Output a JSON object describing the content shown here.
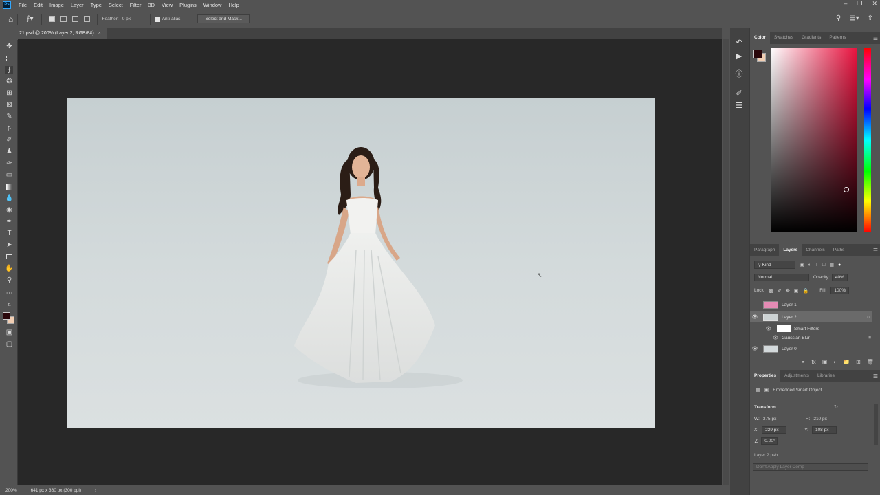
{
  "menu": {
    "app_logo": "Ps",
    "items": [
      "File",
      "Edit",
      "Image",
      "Layer",
      "Type",
      "Select",
      "Filter",
      "3D",
      "View",
      "Plugins",
      "Window",
      "Help"
    ]
  },
  "options": {
    "feather_label": "Feather:",
    "feather_value": "0 px",
    "antialias_label": "Anti-alias",
    "select_mask_label": "Select and Mask..."
  },
  "document": {
    "tab_title": "21.psd @ 200% (Layer 2, RGB/8#)",
    "zoom": "200%",
    "status_info": "641 px x 360 px (300 ppi)"
  },
  "color_panel": {
    "tabs": [
      "Color",
      "Swatches",
      "Gradients",
      "Patterns"
    ],
    "foreground": "#2a070b",
    "background": "#f1ceb3",
    "hue": "#e8133f"
  },
  "layers_panel": {
    "tabs": [
      "Paragraph",
      "Layers",
      "Channels",
      "Paths"
    ],
    "filter_kind": "Kind",
    "blend_mode": "Normal",
    "opacity_label": "Opacity:",
    "opacity_value": "40%",
    "lock_label": "Lock:",
    "fill_label": "Fill:",
    "fill_value": "100%",
    "layers": [
      {
        "name": "Layer 1",
        "visible": false
      },
      {
        "name": "Layer 2",
        "visible": true,
        "selected": true
      },
      {
        "name": "Smart Filters",
        "visible": true
      },
      {
        "name": "Gaussian Blur",
        "visible": true
      },
      {
        "name": "Layer 0",
        "visible": true
      }
    ]
  },
  "properties_panel": {
    "tabs": [
      "Properties",
      "Adjustments",
      "Libraries"
    ],
    "type_label": "Embedded Smart Object",
    "transform_label": "Transform",
    "w_label": "W:",
    "w_value": "375 px",
    "h_label": "H:",
    "h_value": "210 px",
    "x_label": "X:",
    "x_value": "229 px",
    "y_label": "Y:",
    "y_value": "108 px",
    "angle_value": "0.00°",
    "layer_file": "Layer 2.psb",
    "layer_comp": "Don't Apply Layer Comp"
  }
}
